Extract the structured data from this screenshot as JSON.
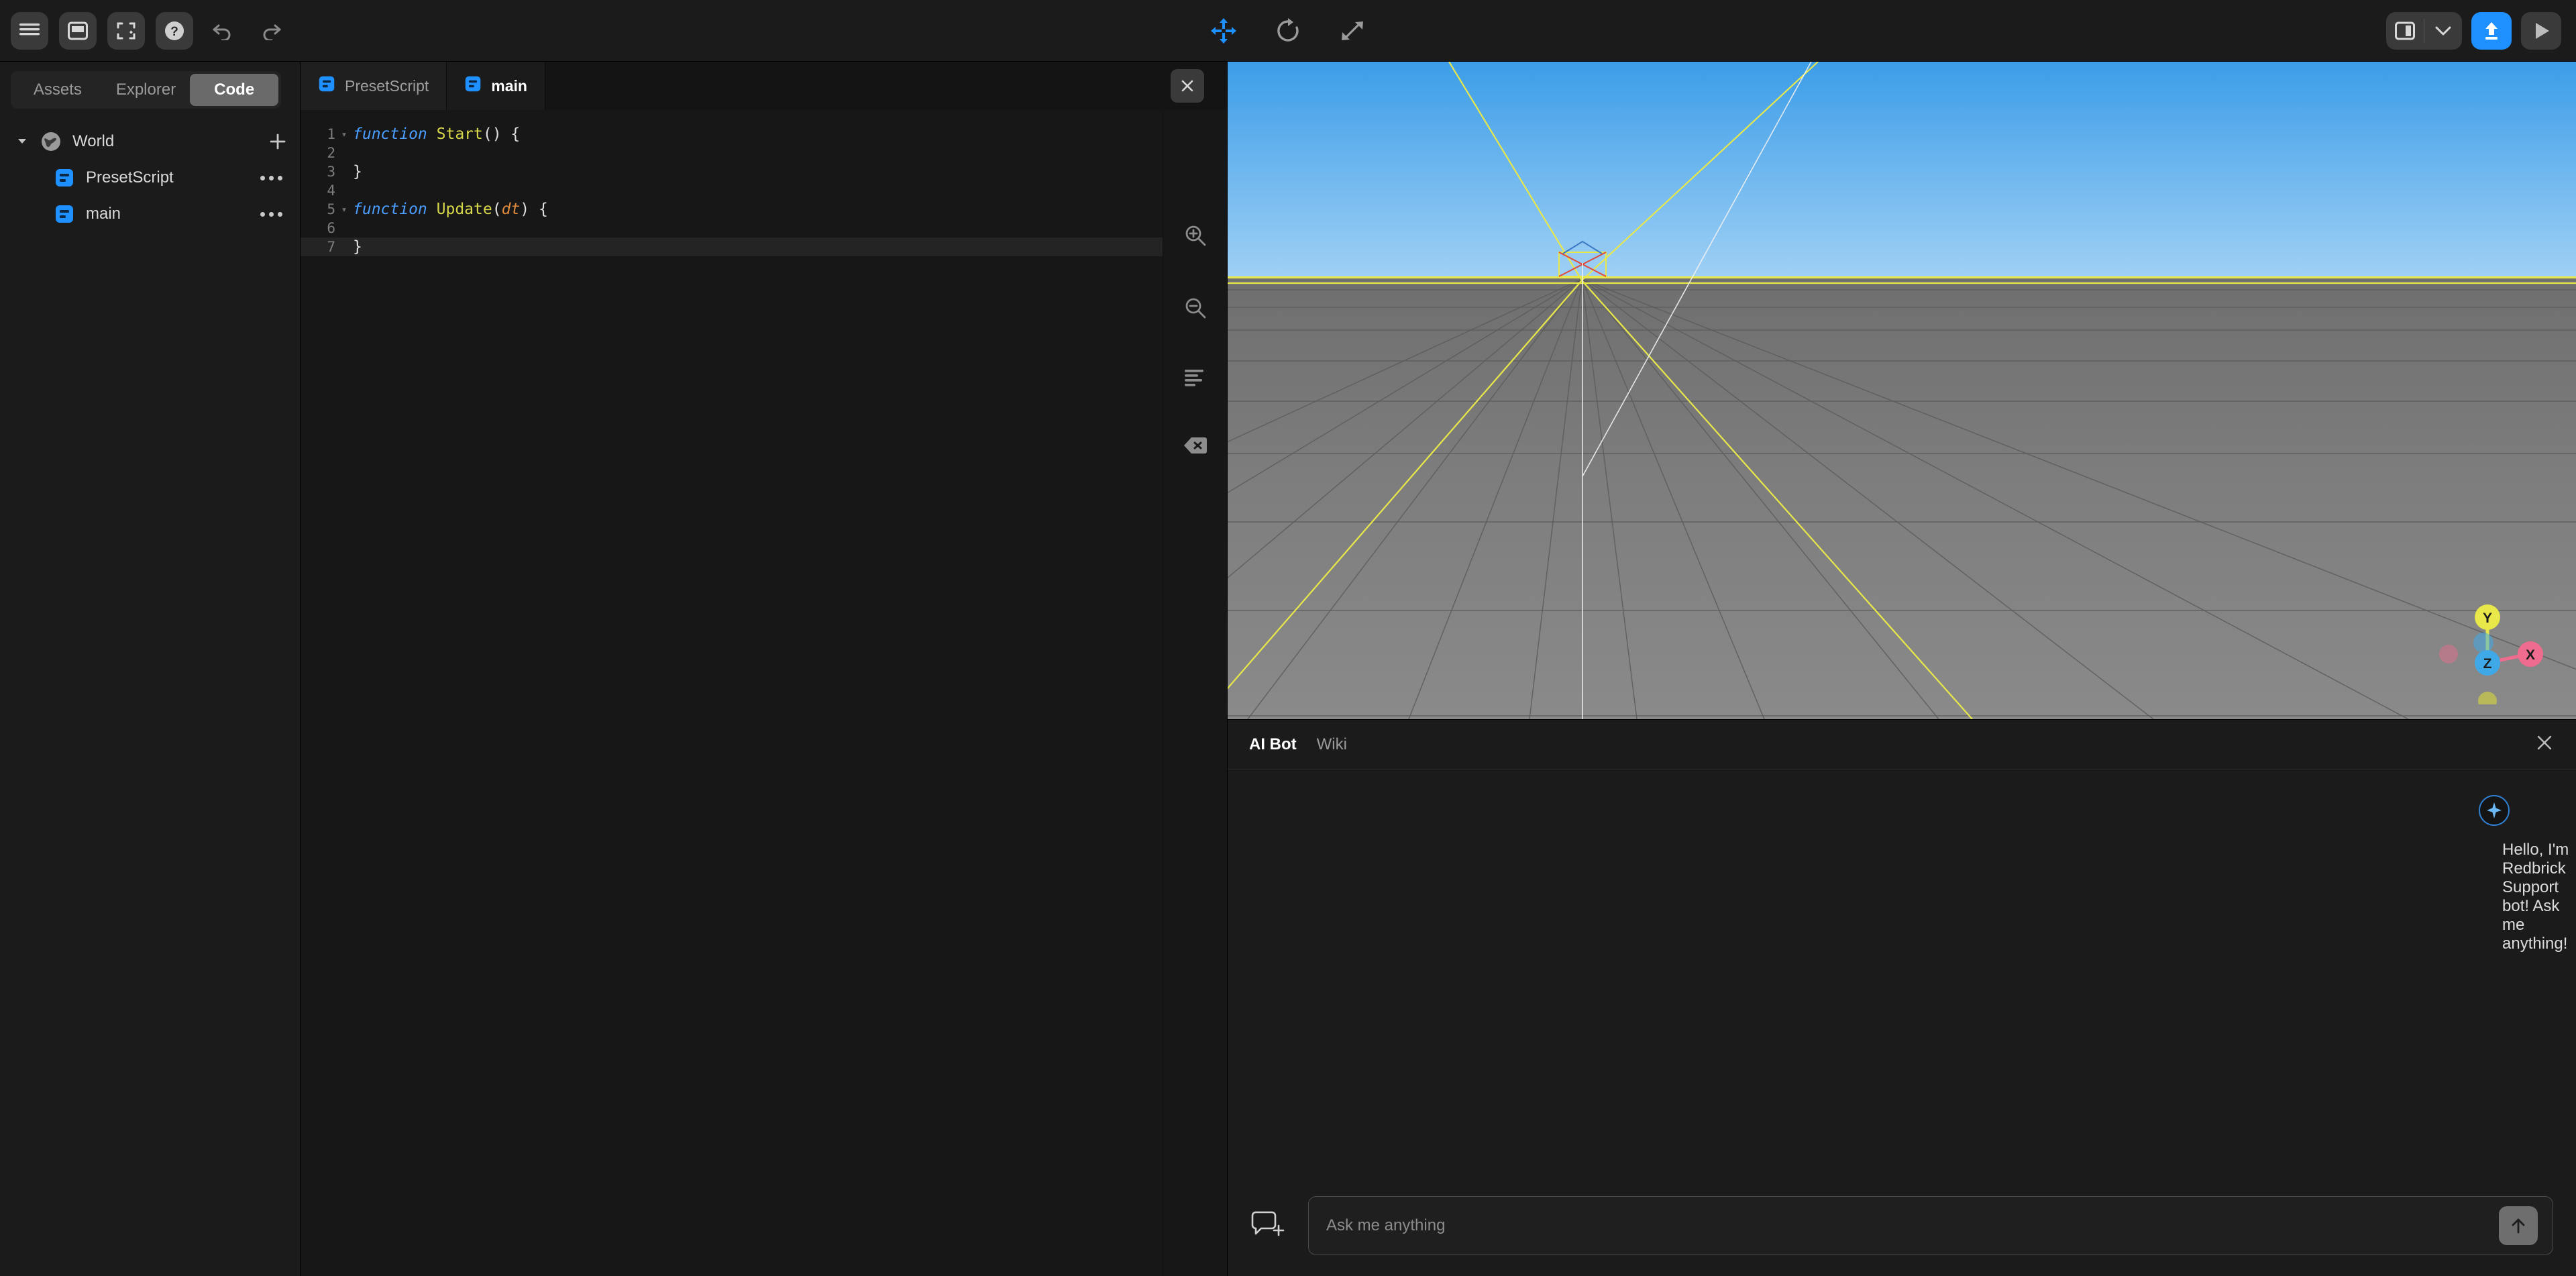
{
  "toolbar": {
    "menu_label": "menu-icon",
    "panel_label": "panel-icon",
    "fullscreen_label": "expand-icon",
    "help_label": "help-icon",
    "undo_label": "undo-icon",
    "redo_label": "redo-icon",
    "move_tool": "move-tool",
    "rotate_tool": "rotate-tool",
    "scale_tool": "scale-tool",
    "layout_label": "layout-icon",
    "layout_chevron": "chevron-down-icon",
    "publish_label": "publish-icon",
    "play_label": "play-icon",
    "accent_blue": "#1e90ff"
  },
  "left_panel": {
    "tabs": [
      {
        "label": "Assets",
        "active": false
      },
      {
        "label": "Explorer",
        "active": false
      },
      {
        "label": "Code",
        "active": true
      }
    ],
    "tree": [
      {
        "label": "World",
        "icon": "globe-icon",
        "depth": 0,
        "expanded": true,
        "has_add": true
      },
      {
        "label": "PresetScript",
        "icon": "script-icon",
        "depth": 1,
        "has_menu": true
      },
      {
        "label": "main",
        "icon": "script-icon",
        "depth": 1,
        "has_menu": true
      }
    ]
  },
  "code_panel": {
    "tabs": [
      {
        "label": "PresetScript",
        "active": false
      },
      {
        "label": "main",
        "active": true
      }
    ],
    "close_label": "close-icon",
    "lines": [
      {
        "n": "1",
        "fold": true,
        "active": false,
        "tokens": [
          {
            "t": "function ",
            "c": "kw"
          },
          {
            "t": "Start",
            "c": "fn"
          },
          {
            "t": "() {",
            "c": "punc"
          }
        ]
      },
      {
        "n": "2",
        "fold": false,
        "active": false,
        "tokens": []
      },
      {
        "n": "3",
        "fold": false,
        "active": false,
        "tokens": [
          {
            "t": "}",
            "c": "punc"
          }
        ]
      },
      {
        "n": "4",
        "fold": false,
        "active": false,
        "tokens": []
      },
      {
        "n": "5",
        "fold": true,
        "active": false,
        "tokens": [
          {
            "t": "function ",
            "c": "kw"
          },
          {
            "t": "Update",
            "c": "fn"
          },
          {
            "t": "(",
            "c": "punc"
          },
          {
            "t": "dt",
            "c": "param"
          },
          {
            "t": ") {",
            "c": "punc"
          }
        ]
      },
      {
        "n": "6",
        "fold": false,
        "active": false,
        "tokens": []
      },
      {
        "n": "7",
        "fold": false,
        "active": true,
        "tokens": [
          {
            "t": "}",
            "c": "punc"
          }
        ]
      }
    ],
    "tools": [
      "zoom-in-icon",
      "zoom-out-icon",
      "format-lines-icon",
      "clear-icon"
    ]
  },
  "viewport": {
    "sky_color": "#9fd0f5",
    "ground_color": "#7d7d7d",
    "grid_color": "#e8e84a",
    "light_label": "directional-light-gizmo",
    "axis": {
      "x": "X",
      "y": "Y",
      "z": "Z",
      "x_color": "#ef6c8e",
      "y_color": "#e8e84a",
      "z_color": "#3fa9e8"
    }
  },
  "ai_panel": {
    "tabs": [
      {
        "label": "AI Bot",
        "active": true
      },
      {
        "label": "Wiki",
        "active": false
      }
    ],
    "close_label": "close-icon",
    "avatar_label": "bot-sparkle-icon",
    "message": "Hello, I'm Redbrick Support bot! Ask me anything!",
    "new_chat_label": "new-chat-icon",
    "input_value": "",
    "input_placeholder": "Ask me anything",
    "send_label": "send-icon"
  }
}
